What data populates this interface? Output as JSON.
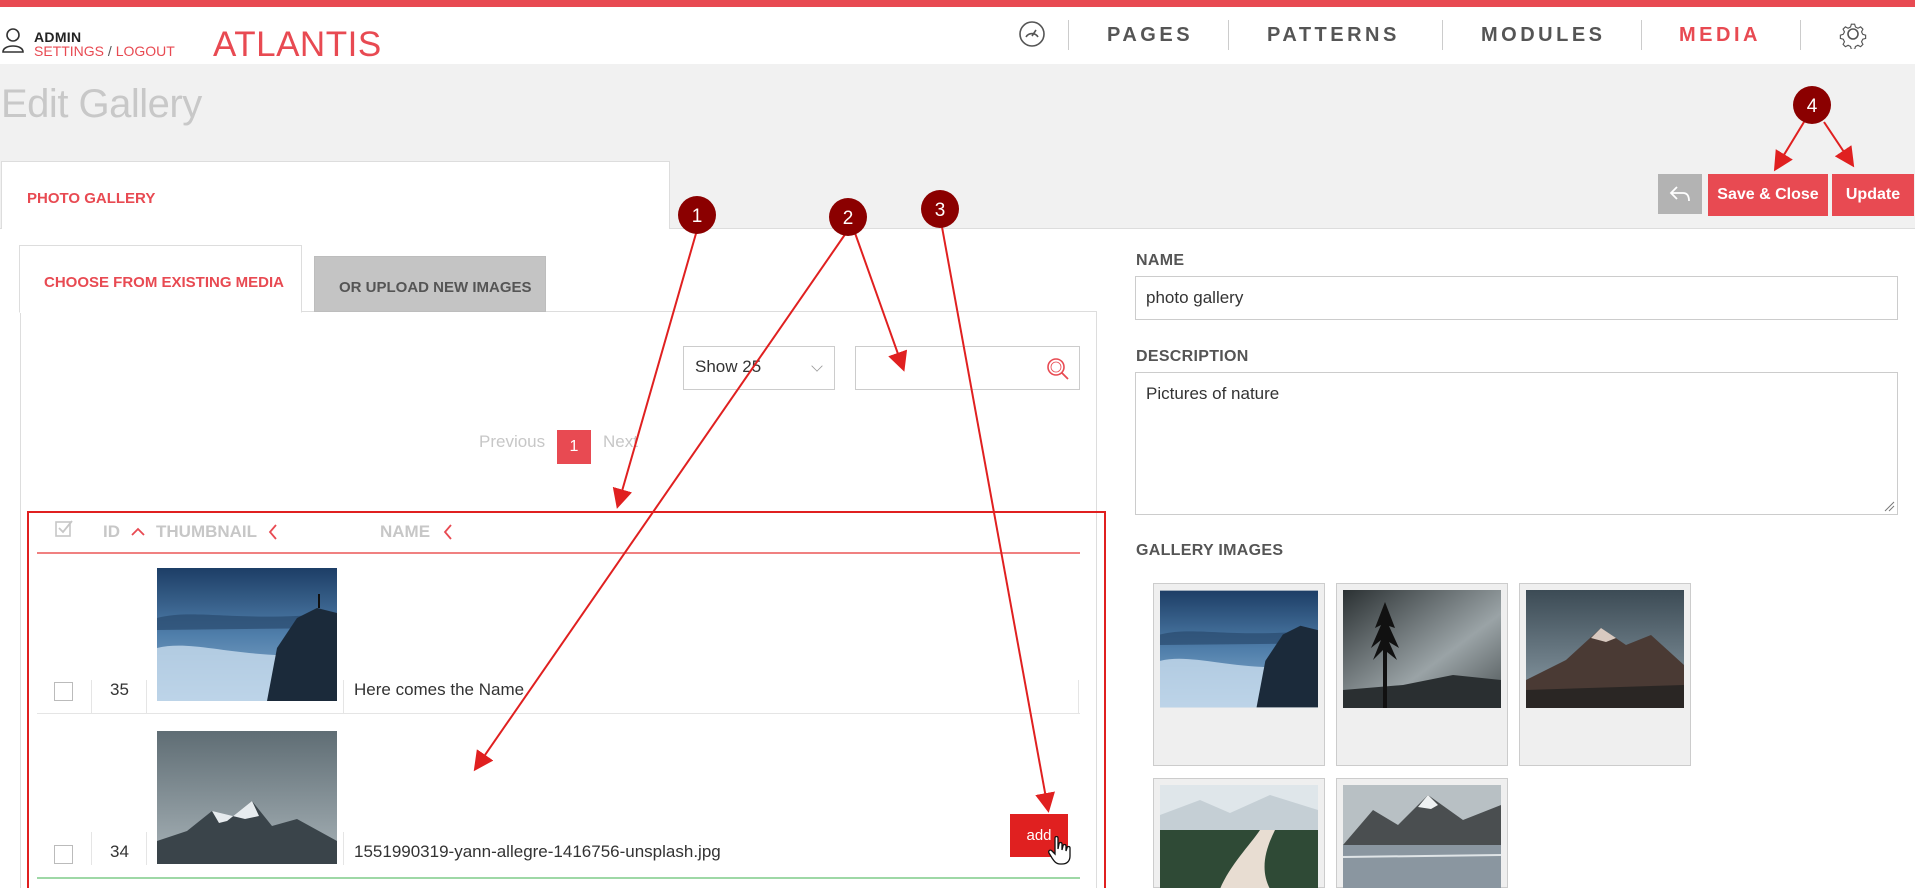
{
  "header": {
    "admin_name": "ADMIN",
    "settings_link": "SETTINGS",
    "separator": "/",
    "logout_link": "LOGOUT",
    "brand": "ATLANTIS",
    "nav": [
      "PAGES",
      "PATTERNS",
      "MODULES",
      "MEDIA"
    ],
    "active_nav": "MEDIA"
  },
  "page_title": "Edit Gallery",
  "panel_tab": "PHOTO GALLERY",
  "actions": {
    "save_close": "Save & Close",
    "update": "Update"
  },
  "media_tabs": {
    "existing": "CHOOSE FROM EXISTING MEDIA",
    "upload": "OR UPLOAD NEW IMAGES"
  },
  "controls": {
    "show_select": "Show 25",
    "search_value": ""
  },
  "pagination": {
    "previous": "Previous",
    "current": "1",
    "next": "Next"
  },
  "table": {
    "columns": [
      "ID",
      "THUMBNAIL",
      "NAME"
    ],
    "rows": [
      {
        "id": "35",
        "name": "Here comes the Name"
      },
      {
        "id": "34",
        "name": "1551990319-yann-allegre-1416756-unsplash.jpg",
        "action": "add"
      }
    ]
  },
  "form": {
    "name_label": "NAME",
    "name_value": "photo gallery",
    "description_label": "DESCRIPTION",
    "description_value": "Pictures of nature",
    "gallery_label": "GALLERY IMAGES"
  },
  "annotations": [
    "1",
    "2",
    "3",
    "4"
  ],
  "colors": {
    "accent": "#e84a52",
    "annotation": "#8b0000",
    "arrow": "#e02020"
  }
}
